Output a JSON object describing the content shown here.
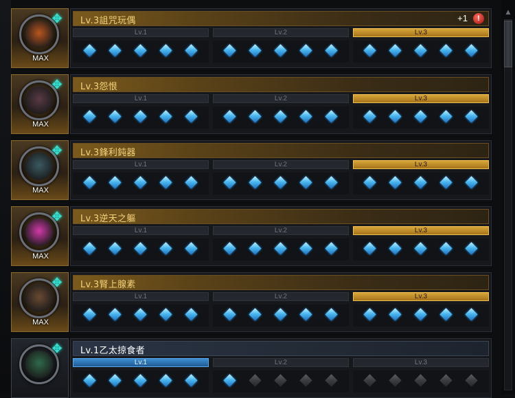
{
  "max_label": "MAX",
  "compass_icon": "✥",
  "items": [
    {
      "title": "Lv.3詛咒玩偶",
      "status": "max",
      "badge_count": "+1",
      "alert": "!",
      "orb_color": "#b8561e",
      "tiers": [
        {
          "label": "Lv.1",
          "state": "dark",
          "gems": [
            true,
            true,
            true,
            true,
            true
          ]
        },
        {
          "label": "Lv.2",
          "state": "dark",
          "gems": [
            true,
            true,
            true,
            true,
            true
          ]
        },
        {
          "label": "Lv.3",
          "state": "gold",
          "gems": [
            true,
            true,
            true,
            true,
            true
          ]
        }
      ]
    },
    {
      "title": "Lv.3怨恨",
      "status": "max",
      "orb_color": "#5a3a44",
      "tiers": [
        {
          "label": "Lv.1",
          "state": "dark",
          "gems": [
            true,
            true,
            true,
            true,
            true
          ]
        },
        {
          "label": "Lv.2",
          "state": "dark",
          "gems": [
            true,
            true,
            true,
            true,
            true
          ]
        },
        {
          "label": "Lv.3",
          "state": "gold",
          "gems": [
            true,
            true,
            true,
            true,
            true
          ]
        }
      ]
    },
    {
      "title": "Lv.3鋒利鈍器",
      "status": "max",
      "orb_color": "#3a5a62",
      "tiers": [
        {
          "label": "Lv.1",
          "state": "dark",
          "gems": [
            true,
            true,
            true,
            true,
            true
          ]
        },
        {
          "label": "Lv.2",
          "state": "dark",
          "gems": [
            true,
            true,
            true,
            true,
            true
          ]
        },
        {
          "label": "Lv.3",
          "state": "gold",
          "gems": [
            true,
            true,
            true,
            true,
            true
          ]
        }
      ]
    },
    {
      "title": "Lv.3逆天之軀",
      "status": "max",
      "orb_color": "#d23aa8",
      "tiers": [
        {
          "label": "Lv.1",
          "state": "dark",
          "gems": [
            true,
            true,
            true,
            true,
            true
          ]
        },
        {
          "label": "Lv.2",
          "state": "dark",
          "gems": [
            true,
            true,
            true,
            true,
            true
          ]
        },
        {
          "label": "Lv.3",
          "state": "gold",
          "gems": [
            true,
            true,
            true,
            true,
            true
          ]
        }
      ]
    },
    {
      "title": "Lv.3腎上腺素",
      "status": "max",
      "orb_color": "#6a4a32",
      "tiers": [
        {
          "label": "Lv.1",
          "state": "dark",
          "gems": [
            true,
            true,
            true,
            true,
            true
          ]
        },
        {
          "label": "Lv.2",
          "state": "dark",
          "gems": [
            true,
            true,
            true,
            true,
            true
          ]
        },
        {
          "label": "Lv.3",
          "state": "gold",
          "gems": [
            true,
            true,
            true,
            true,
            true
          ]
        }
      ]
    },
    {
      "title": "Lv.1乙太掠食者",
      "status": "normal",
      "orb_color": "#2f6a4a",
      "tiers": [
        {
          "label": "Lv.1",
          "state": "blue",
          "gems": [
            true,
            true,
            true,
            true,
            true
          ]
        },
        {
          "label": "Lv.2",
          "state": "dark",
          "gems": [
            true,
            false,
            false,
            false,
            false
          ]
        },
        {
          "label": "Lv.3",
          "state": "dark",
          "gems": [
            false,
            false,
            false,
            false,
            false
          ]
        }
      ]
    }
  ]
}
